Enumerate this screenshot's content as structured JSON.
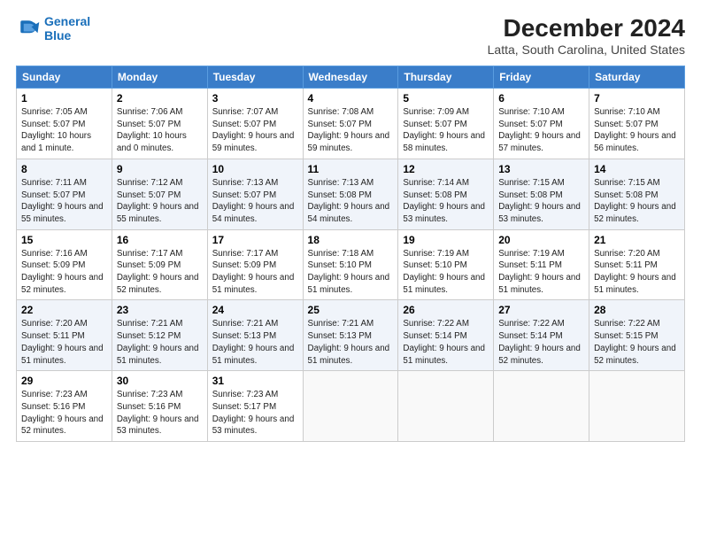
{
  "header": {
    "logo_line1": "General",
    "logo_line2": "Blue",
    "main_title": "December 2024",
    "subtitle": "Latta, South Carolina, United States"
  },
  "columns": [
    "Sunday",
    "Monday",
    "Tuesday",
    "Wednesday",
    "Thursday",
    "Friday",
    "Saturday"
  ],
  "weeks": [
    [
      {
        "day": "1",
        "sunrise": "7:05 AM",
        "sunset": "5:07 PM",
        "daylight": "10 hours and 1 minute."
      },
      {
        "day": "2",
        "sunrise": "7:06 AM",
        "sunset": "5:07 PM",
        "daylight": "10 hours and 0 minutes."
      },
      {
        "day": "3",
        "sunrise": "7:07 AM",
        "sunset": "5:07 PM",
        "daylight": "9 hours and 59 minutes."
      },
      {
        "day": "4",
        "sunrise": "7:08 AM",
        "sunset": "5:07 PM",
        "daylight": "9 hours and 59 minutes."
      },
      {
        "day": "5",
        "sunrise": "7:09 AM",
        "sunset": "5:07 PM",
        "daylight": "9 hours and 58 minutes."
      },
      {
        "day": "6",
        "sunrise": "7:10 AM",
        "sunset": "5:07 PM",
        "daylight": "9 hours and 57 minutes."
      },
      {
        "day": "7",
        "sunrise": "7:10 AM",
        "sunset": "5:07 PM",
        "daylight": "9 hours and 56 minutes."
      }
    ],
    [
      {
        "day": "8",
        "sunrise": "7:11 AM",
        "sunset": "5:07 PM",
        "daylight": "9 hours and 55 minutes."
      },
      {
        "day": "9",
        "sunrise": "7:12 AM",
        "sunset": "5:07 PM",
        "daylight": "9 hours and 55 minutes."
      },
      {
        "day": "10",
        "sunrise": "7:13 AM",
        "sunset": "5:07 PM",
        "daylight": "9 hours and 54 minutes."
      },
      {
        "day": "11",
        "sunrise": "7:13 AM",
        "sunset": "5:08 PM",
        "daylight": "9 hours and 54 minutes."
      },
      {
        "day": "12",
        "sunrise": "7:14 AM",
        "sunset": "5:08 PM",
        "daylight": "9 hours and 53 minutes."
      },
      {
        "day": "13",
        "sunrise": "7:15 AM",
        "sunset": "5:08 PM",
        "daylight": "9 hours and 53 minutes."
      },
      {
        "day": "14",
        "sunrise": "7:15 AM",
        "sunset": "5:08 PM",
        "daylight": "9 hours and 52 minutes."
      }
    ],
    [
      {
        "day": "15",
        "sunrise": "7:16 AM",
        "sunset": "5:09 PM",
        "daylight": "9 hours and 52 minutes."
      },
      {
        "day": "16",
        "sunrise": "7:17 AM",
        "sunset": "5:09 PM",
        "daylight": "9 hours and 52 minutes."
      },
      {
        "day": "17",
        "sunrise": "7:17 AM",
        "sunset": "5:09 PM",
        "daylight": "9 hours and 51 minutes."
      },
      {
        "day": "18",
        "sunrise": "7:18 AM",
        "sunset": "5:10 PM",
        "daylight": "9 hours and 51 minutes."
      },
      {
        "day": "19",
        "sunrise": "7:19 AM",
        "sunset": "5:10 PM",
        "daylight": "9 hours and 51 minutes."
      },
      {
        "day": "20",
        "sunrise": "7:19 AM",
        "sunset": "5:11 PM",
        "daylight": "9 hours and 51 minutes."
      },
      {
        "day": "21",
        "sunrise": "7:20 AM",
        "sunset": "5:11 PM",
        "daylight": "9 hours and 51 minutes."
      }
    ],
    [
      {
        "day": "22",
        "sunrise": "7:20 AM",
        "sunset": "5:11 PM",
        "daylight": "9 hours and 51 minutes."
      },
      {
        "day": "23",
        "sunrise": "7:21 AM",
        "sunset": "5:12 PM",
        "daylight": "9 hours and 51 minutes."
      },
      {
        "day": "24",
        "sunrise": "7:21 AM",
        "sunset": "5:13 PM",
        "daylight": "9 hours and 51 minutes."
      },
      {
        "day": "25",
        "sunrise": "7:21 AM",
        "sunset": "5:13 PM",
        "daylight": "9 hours and 51 minutes."
      },
      {
        "day": "26",
        "sunrise": "7:22 AM",
        "sunset": "5:14 PM",
        "daylight": "9 hours and 51 minutes."
      },
      {
        "day": "27",
        "sunrise": "7:22 AM",
        "sunset": "5:14 PM",
        "daylight": "9 hours and 52 minutes."
      },
      {
        "day": "28",
        "sunrise": "7:22 AM",
        "sunset": "5:15 PM",
        "daylight": "9 hours and 52 minutes."
      }
    ],
    [
      {
        "day": "29",
        "sunrise": "7:23 AM",
        "sunset": "5:16 PM",
        "daylight": "9 hours and 52 minutes."
      },
      {
        "day": "30",
        "sunrise": "7:23 AM",
        "sunset": "5:16 PM",
        "daylight": "9 hours and 53 minutes."
      },
      {
        "day": "31",
        "sunrise": "7:23 AM",
        "sunset": "5:17 PM",
        "daylight": "9 hours and 53 minutes."
      },
      null,
      null,
      null,
      null
    ]
  ],
  "labels": {
    "sunrise": "Sunrise:",
    "sunset": "Sunset:",
    "daylight": "Daylight:"
  }
}
